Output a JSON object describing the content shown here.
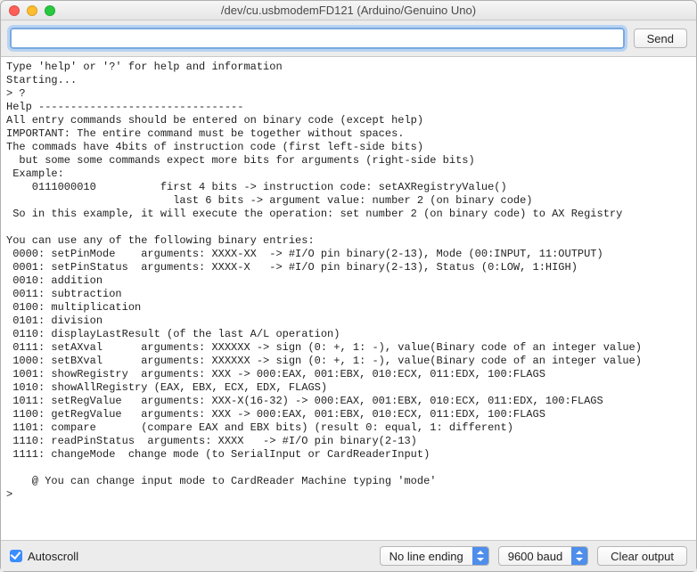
{
  "window": {
    "title": "/dev/cu.usbmodemFD121 (Arduino/Genuino Uno)"
  },
  "inputbar": {
    "command_value": "",
    "send_label": "Send"
  },
  "console_text": "Type 'help' or '?' for help and information\nStarting...\n> ?\nHelp --------------------------------\nAll entry commands should be entered on binary code (except help)\nIMPORTANT: The entire command must be together without spaces.\nThe commads have 4bits of instruction code (first left-side bits)\n  but some some commands expect more bits for arguments (right-side bits)\n Example:\n    0111000010          first 4 bits -> instruction code: setAXRegistryValue()\n                          last 6 bits -> argument value: number 2 (on binary code)\n So in this example, it will execute the operation: set number 2 (on binary code) to AX Registry\n\nYou can use any of the following binary entries:\n 0000: setPinMode    arguments: XXXX-XX  -> #I/O pin binary(2-13), Mode (00:INPUT, 11:OUTPUT)\n 0001: setPinStatus  arguments: XXXX-X   -> #I/O pin binary(2-13), Status (0:LOW, 1:HIGH)\n 0010: addition\n 0011: subtraction\n 0100: multiplication\n 0101: division\n 0110: displayLastResult (of the last A/L operation)\n 0111: setAXval      arguments: XXXXXX -> sign (0: +, 1: -), value(Binary code of an integer value)\n 1000: setBXval      arguments: XXXXXX -> sign (0: +, 1: -), value(Binary code of an integer value)\n 1001: showRegistry  arguments: XXX -> 000:EAX, 001:EBX, 010:ECX, 011:EDX, 100:FLAGS\n 1010: showAllRegistry (EAX, EBX, ECX, EDX, FLAGS)\n 1011: setRegValue   arguments: XXX-X(16-32) -> 000:EAX, 001:EBX, 010:ECX, 011:EDX, 100:FLAGS\n 1100: getRegValue   arguments: XXX -> 000:EAX, 001:EBX, 010:ECX, 011:EDX, 100:FLAGS\n 1101: compare       (compare EAX and EBX bits) (result 0: equal, 1: different)\n 1110: readPinStatus  arguments: XXXX   -> #I/O pin binary(2-13)\n 1111: changeMode  change mode (to SerialInput or CardReaderInput)\n\n    @ You can change input mode to CardReader Machine typing 'mode'\n>",
  "bottombar": {
    "autoscroll_label": "Autoscroll",
    "autoscroll_checked": true,
    "line_ending_selected": "No line ending",
    "baud_selected": "9600 baud",
    "clear_label": "Clear output"
  }
}
